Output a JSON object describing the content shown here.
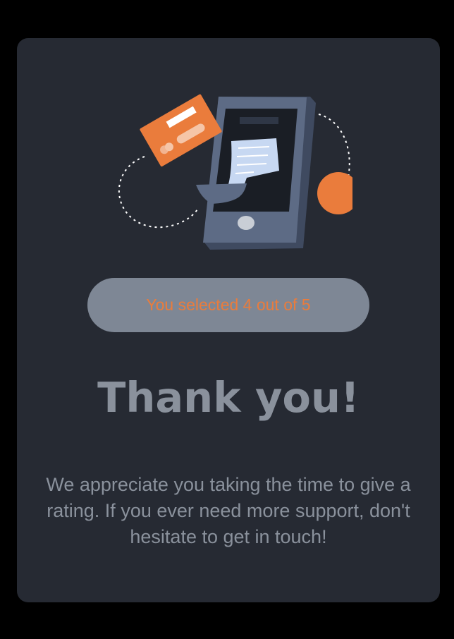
{
  "thank_you": {
    "selection_text": "You selected 4 out of 5",
    "title": "Thank you!",
    "message": "We appreciate you taking the time to give a rating. If you ever need more support, don't hesitate to get in touch!"
  },
  "illustration": {
    "icons": [
      "phone-icon",
      "credit-card-icon",
      "receipt-icon",
      "orange-dot-icon"
    ],
    "colors": {
      "accent": "#ea7c3c",
      "phone_body": "#5d6b85",
      "phone_screen": "#1a1e25",
      "receipt": "#c7d8f2",
      "card_background": "#262a33",
      "pill_background": "#7e8795",
      "text": "#8a919c"
    }
  }
}
